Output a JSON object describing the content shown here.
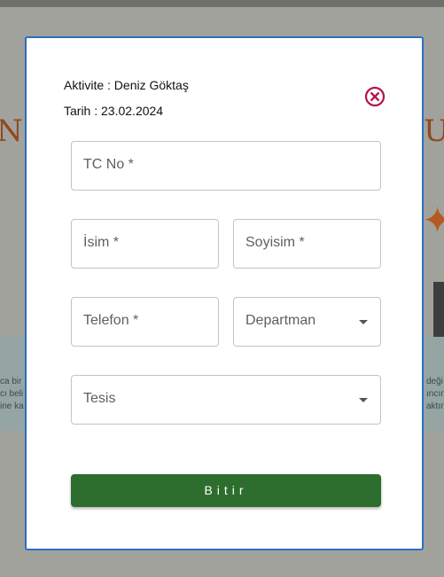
{
  "background": {
    "left_text_lines": [
      "ca bir",
      "cı beli",
      "ine ka"
    ],
    "right_text_lines": [
      "deği",
      "ıncını",
      "aktır"
    ],
    "big_left_glyph": "N",
    "big_right_glyph": "U"
  },
  "modal": {
    "activity_line": "Aktivite : Deniz Göktaş",
    "date_line": "Tarih : 23.02.2024",
    "close_icon": "close-circle-icon",
    "fields": {
      "tc": "TC No *",
      "first_name": "İsim *",
      "last_name": "Soyisim *",
      "phone": "Telefon *",
      "department": "Departman",
      "facility": "Tesis"
    },
    "submit_label": "Bitir"
  },
  "colors": {
    "accent_border": "#2c6fc2",
    "close_icon": "#b3134b",
    "submit": "#2d6e2f"
  }
}
